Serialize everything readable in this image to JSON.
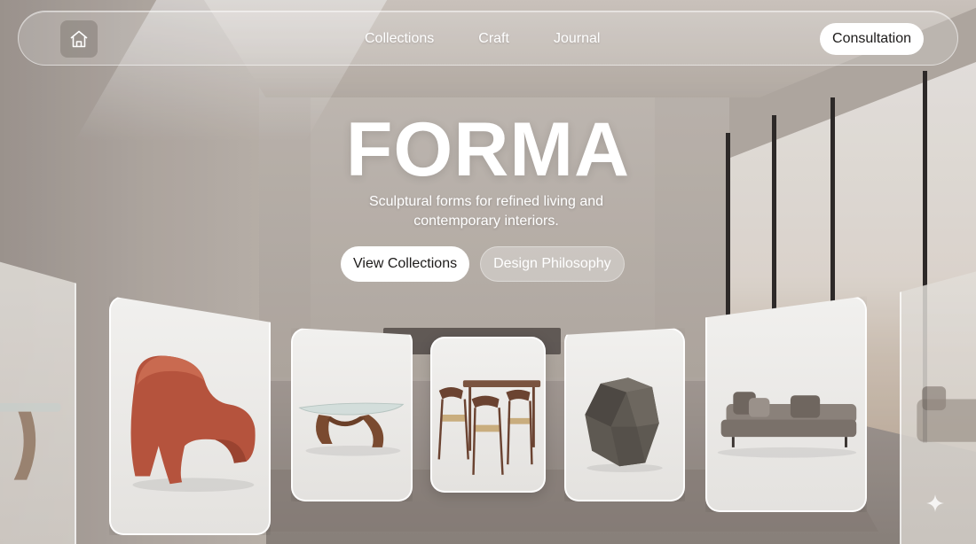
{
  "brand": {
    "title": "FORMA",
    "subtitle": "Sculptural forms for refined living and contemporary interiors."
  },
  "nav": {
    "home_icon": "home-icon",
    "links": [
      "Collections",
      "Craft",
      "Journal"
    ],
    "cta_label": "Consultation"
  },
  "hero": {
    "primary_button": "View Collections",
    "secondary_button": "Design Philosophy"
  },
  "products": [
    {
      "name": "glass-coffee-table-partial",
      "color": "#8a6a52"
    },
    {
      "name": "terracotta-lounge-chair",
      "color": "#b5533d"
    },
    {
      "name": "glass-coffee-table",
      "color": "#7a4a30"
    },
    {
      "name": "dining-table-set",
      "color": "#6b4331"
    },
    {
      "name": "faceted-side-table",
      "color": "#5e5952"
    },
    {
      "name": "daybed-sofa",
      "color": "#7a716a"
    },
    {
      "name": "sofa-partial",
      "color": "#9a918a"
    }
  ],
  "decor": {
    "sparkle_icon": "sparkle-icon"
  }
}
